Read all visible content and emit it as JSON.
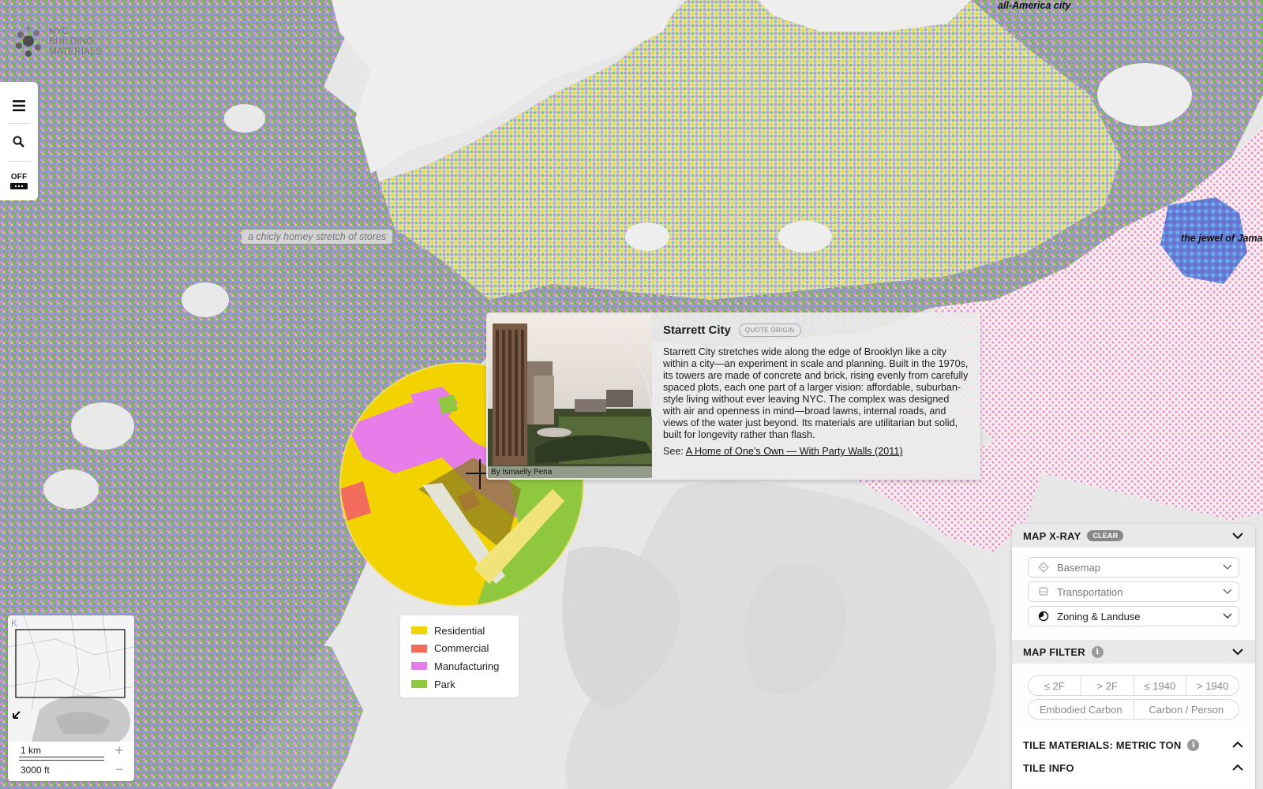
{
  "app": {
    "logo_lines": [
      "NYC",
      "BUILDING",
      "MATERIALS"
    ]
  },
  "toolbar": {
    "menu_icon": "menu-icon",
    "search_icon": "search-icon",
    "toggle_label": "OFF"
  },
  "map": {
    "quote_labels": [
      "a chicly homey stretch of stores",
      "the jewel of Jamaic",
      "all-America city"
    ],
    "colors": {
      "residential": "#f2d300",
      "commercial": "#f26b5b",
      "manufacturing": "#e77de8",
      "park": "#8fc73e",
      "extra_blue": "#6aa5e8"
    }
  },
  "popup": {
    "title": "Starrett City",
    "quote_origin": "QUOTE ORIGIN",
    "photo_credit": "By Ismaelly Pena",
    "text": "Starrett City stretches wide along the edge of Brooklyn like a city within a city—an experiment in scale and planning. Built in the 1970s, its towers are made of concrete and brick, rising evenly from carefully spaced plots, each one part of a larger vision: affordable, suburban-style living without ever leaving NYC. The complex was designed with air and openness in mind—broad lawns, internal roads, and views of the water just beyond. Its materials are utilitarian but solid, built for longevity rather than flash.",
    "see_label": "See:",
    "see_link": "A Home of One’s Own — With Party Walls (2011)"
  },
  "zoning_legend": [
    {
      "label": "Residential",
      "color": "#f2d300"
    },
    {
      "label": "Commercial",
      "color": "#f26b5b"
    },
    {
      "label": "Manufacturing",
      "color": "#e77de8"
    },
    {
      "label": "Park",
      "color": "#8fc73e"
    }
  ],
  "minimap": {
    "scale_metric": "1 km",
    "scale_imperial": "3000 ft",
    "zoom_in": "+",
    "zoom_out": "−",
    "corner_letter": "K"
  },
  "panel": {
    "xray_title": "MAP X-RAY",
    "clear_label": "CLEAR",
    "layers": [
      {
        "label": "Basemap",
        "icon": "basemap-icon",
        "active": false
      },
      {
        "label": "Transportation",
        "icon": "transportation-icon",
        "active": false
      },
      {
        "label": "Zoning & Landuse",
        "icon": "zoning-icon",
        "active": true
      }
    ],
    "filter_title": "MAP FILTER",
    "filter_pills_row1": [
      "≤ 2F",
      "> 2F",
      "≤ 1940",
      "> 1940"
    ],
    "filter_pills_row2": [
      "Embodied Carbon",
      "Carbon / Person"
    ],
    "tile_materials_title": "TILE MATERIALS: METRIC TON",
    "tile_info_title": "TILE INFO"
  }
}
